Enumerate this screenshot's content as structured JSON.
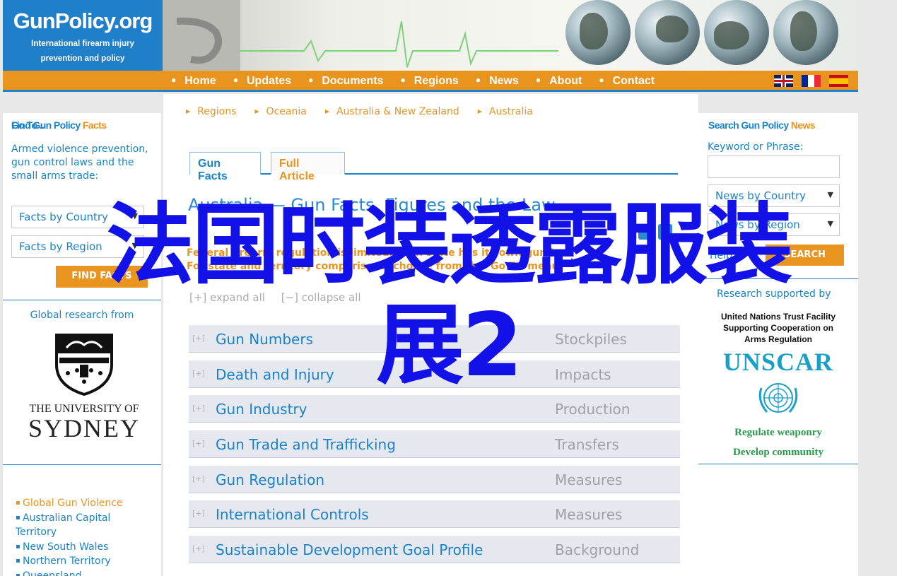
{
  "header": {
    "logo_name": "GunPolicy.org",
    "logo_tagline_1": "International firearm injury",
    "logo_tagline_2": "prevention and policy"
  },
  "nav": {
    "items": [
      "Home",
      "Updates",
      "Documents",
      "Regions",
      "News",
      "About",
      "Contact"
    ],
    "languages": [
      "English",
      "Français",
      "Español"
    ]
  },
  "left_sidebar": {
    "find_title_part1": "Find Gun Policy",
    "find_title_part2": "Facts",
    "intro": "Armed violence prevention, gun control laws and the small arms trade:",
    "select_country": "Facts by Country",
    "select_region": "Facts by Region",
    "find_button": "FIND FACTS",
    "global_research": "Global research from",
    "university_line1": "THE UNIVERSITY OF",
    "university_line2": "SYDNEY",
    "goto_title": "Go To ..",
    "goto_items": [
      "Global Gun Violence",
      "Australian Capital Territory",
      "New South Wales",
      "Northern Territory",
      "Queensland"
    ]
  },
  "main": {
    "breadcrumb": [
      "Regions",
      "Oceania",
      "Australia & New Zealand",
      "Australia"
    ],
    "tab_gun_facts": "Gun Facts",
    "tab_full_article": "Full Article",
    "heading": "Australia — Gun Facts, Figures and the Law",
    "intro_line1": "Federal firearm regulation is limited: each state has its own gun law.",
    "intro_line2": "For state and territory comparisons, choose from the 'Go To' menu",
    "expand_all": "[+] expand all",
    "collapse_all": "[−] collapse all",
    "rows": [
      {
        "label": "Gun Numbers",
        "category": "Stockpiles"
      },
      {
        "label": "Death and Injury",
        "category": "Impacts"
      },
      {
        "label": "Gun Industry",
        "category": "Production"
      },
      {
        "label": "Gun Trade and Trafficking",
        "category": "Transfers"
      },
      {
        "label": "Gun Regulation",
        "category": "Measures"
      },
      {
        "label": "International Controls",
        "category": "Measures"
      },
      {
        "label": "Sustainable Development Goal Profile",
        "category": "Background"
      }
    ],
    "row_expander": "[+]"
  },
  "right_sidebar": {
    "search_title_part1": "Search Gun Policy",
    "search_title_part2": "News",
    "keyword_label": "Keyword or Phrase:",
    "keyword_value": "",
    "select_country": "News by Country",
    "select_region": "News by Region",
    "help": "Help",
    "search_button": "SEARCH",
    "research_supported": "Research supported by",
    "trust_line1": "United Nations Trust Facility",
    "trust_line2": "Supporting Cooperation on",
    "trust_line3": "Arms Regulation",
    "unscar": "UNSCAR",
    "motto_line1": "Regulate weaponry",
    "motto_line2": "Develop community"
  },
  "overlay": {
    "line1": "法国时装透露服装",
    "line2": "展2"
  },
  "colors": {
    "brand_blue": "#1f7fc8",
    "accent_orange": "#e8941f",
    "overlay_blue": "#1212e8"
  }
}
